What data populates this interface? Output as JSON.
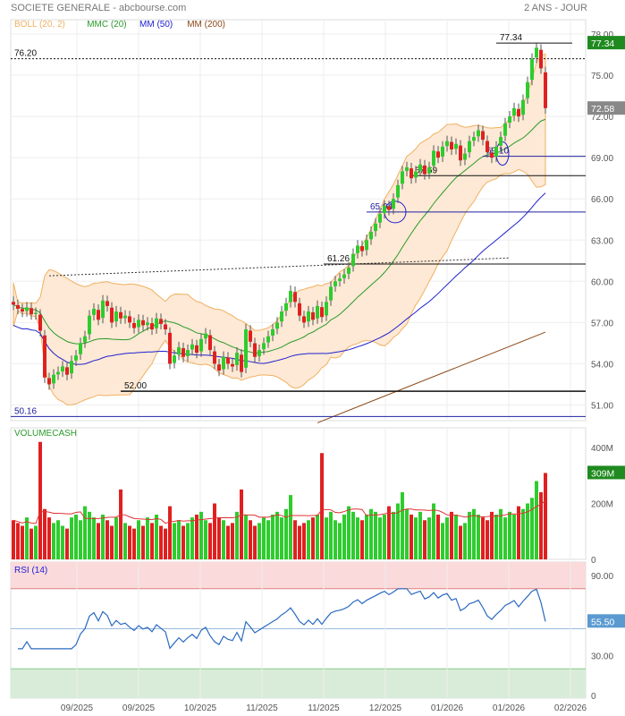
{
  "header": {
    "title": "SOCIETE GENERALE - abcbourse.com",
    "period": "2 ANS - JOUR"
  },
  "legend": [
    {
      "label": "BOLL (20, 2)",
      "color": "#f0b060"
    },
    {
      "label": "MMC (20)",
      "color": "#2a9a2a"
    },
    {
      "label": "MM (50)",
      "color": "#2020d0"
    },
    {
      "label": "MM (200)",
      "color": "#8b4a1a"
    }
  ],
  "price_axis": [
    "78.00",
    "75.00",
    "72.00",
    "69.00",
    "66.00",
    "63.00",
    "60.00",
    "57.00",
    "54.00",
    "51.00"
  ],
  "price_badges": {
    "last_high": "77.34",
    "close": "72.58"
  },
  "levels": [
    {
      "label": "77.34",
      "value": 77.34
    },
    {
      "label": "76.20",
      "value": 76.2
    },
    {
      "label": "69.10",
      "value": 69.1
    },
    {
      "label": "67.69",
      "value": 67.69
    },
    {
      "label": "65.04",
      "value": 65.04
    },
    {
      "label": "61.26",
      "value": 61.26
    },
    {
      "label": "52.00",
      "value": 52.0
    },
    {
      "label": "50.16",
      "value": 50.16
    }
  ],
  "volume": {
    "title": "VOLUMECASH",
    "axis": [
      "400M",
      "200M",
      "0"
    ],
    "badge": "309M"
  },
  "rsi": {
    "title": "RSI (14)",
    "axis": [
      "90.00",
      "30.00",
      "0"
    ],
    "badge": "55.50"
  },
  "x_axis": [
    "09/2025",
    "09/2025",
    "10/2025",
    "11/2025",
    "11/2025",
    "12/2025",
    "01/2026",
    "01/2026",
    "02/2026"
  ],
  "chart_data": {
    "type": "candlestick",
    "closes": [
      58.3,
      58.0,
      57.8,
      58.1,
      57.6,
      57.7,
      56.4,
      53.0,
      52.5,
      53.2,
      53.4,
      53.8,
      53.2,
      54.2,
      54.6,
      55.5,
      56.0,
      57.5,
      58.0,
      57.2,
      58.6,
      58.2,
      57.0,
      57.8,
      57.3,
      57.5,
      57.0,
      56.6,
      57.2,
      56.8,
      57.0,
      56.5,
      57.3,
      56.9,
      56.5,
      54.0,
      54.6,
      55.2,
      54.5,
      55.0,
      55.4,
      54.8,
      55.8,
      56.2,
      55.0,
      54.0,
      53.5,
      54.5,
      54.0,
      53.8,
      54.8,
      53.4,
      56.5,
      55.6,
      54.5,
      55.0,
      55.5,
      56.0,
      56.5,
      57.0,
      57.8,
      58.4,
      59.3,
      58.5,
      57.5,
      57.0,
      57.8,
      57.2,
      58.2,
      57.4,
      58.5,
      59.6,
      60.0,
      60.2,
      60.5,
      61.0,
      62.0,
      62.6,
      62.2,
      63.0,
      63.6,
      64.2,
      64.9,
      65.5,
      65.2,
      66.0,
      67.0,
      68.0,
      68.3,
      67.5,
      68.0,
      68.5,
      67.8,
      68.3,
      69.5,
      69.0,
      69.8,
      70.2,
      69.6,
      70.0,
      68.8,
      69.3,
      70.2,
      70.5,
      71.0,
      70.3,
      69.4,
      69.0,
      69.8,
      70.5,
      71.5,
      72.0,
      72.6,
      72.0,
      73.2,
      74.5,
      76.2,
      77.0,
      75.5,
      72.6
    ],
    "volumes": [
      140,
      130,
      120,
      150,
      110,
      120,
      420,
      180,
      150,
      130,
      140,
      120,
      110,
      150,
      160,
      140,
      190,
      170,
      150,
      130,
      160,
      140,
      120,
      150,
      250,
      130,
      120,
      110,
      140,
      120,
      150,
      130,
      160,
      120,
      110,
      190,
      130,
      140,
      120,
      130,
      150,
      160,
      170,
      140,
      130,
      200,
      150,
      140,
      120,
      130,
      170,
      250,
      160,
      140,
      120,
      130,
      150,
      140,
      160,
      170,
      150,
      180,
      230,
      140,
      120,
      130,
      140,
      150,
      160,
      380,
      150,
      170,
      140,
      130,
      160,
      190,
      170,
      150,
      140,
      160,
      180,
      170,
      150,
      160,
      190,
      170,
      200,
      240,
      180,
      160,
      150,
      170,
      140,
      150,
      200,
      160,
      130,
      150,
      170,
      160,
      120,
      130,
      170,
      180,
      160,
      150,
      140,
      170,
      160,
      180,
      150,
      170,
      160,
      190,
      180,
      200,
      220,
      280,
      240,
      309
    ],
    "mm200": [
      [
        68,
        49.7
      ],
      [
        119,
        56.3
      ]
    ],
    "trendline": [
      [
        8,
        60.4
      ],
      [
        111,
        61.7
      ]
    ],
    "price_range": [
      49.7,
      78.6
    ],
    "volume_range": [
      0,
      460
    ],
    "rsi_range": [
      0,
      100
    ]
  }
}
